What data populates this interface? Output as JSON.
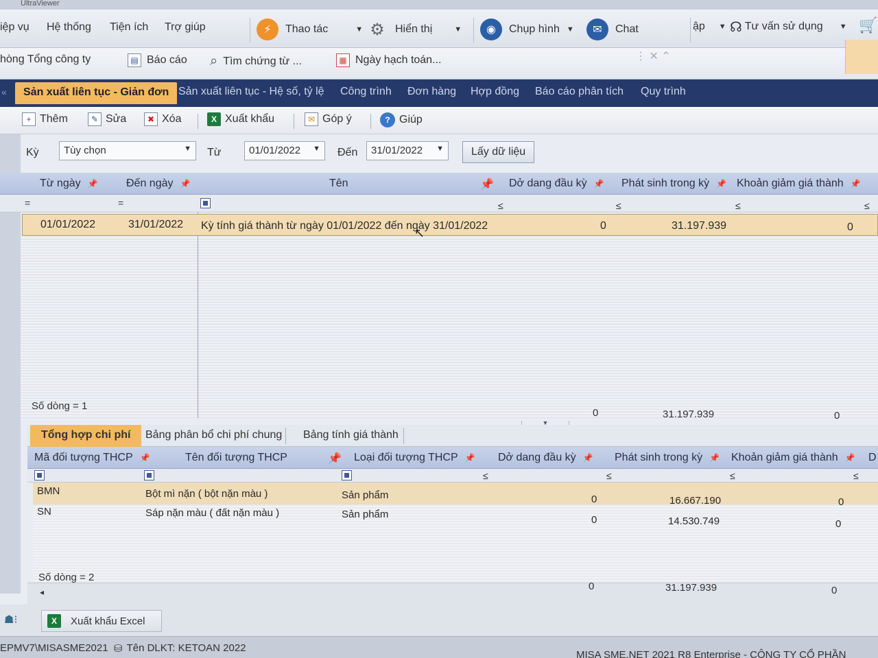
{
  "window": {
    "title": "UltraViewer"
  },
  "menubar": {
    "items": [
      "iệp vụ",
      "Hệ thống",
      "Tiện ích",
      "Trợ giúp"
    ],
    "tools": {
      "thao_tac": "Thao tác",
      "hien_thi": "Hiển thị",
      "chup_hinh": "Chụp hình",
      "chat": "Chat",
      "ap": "ập",
      "tu_van": "Tư vấn sử dụng"
    }
  },
  "toolbar2": {
    "company": "hòng Tổng công ty",
    "bao_cao": "Báo cáo",
    "tim_chung_tu": "Tìm chứng từ ...",
    "ngay_hach_toan": "Ngày hạch toán..."
  },
  "tabs": [
    "Sản xuất liên tục - Giản đơn",
    "Sản xuất liên tục - Hệ số, tỷ lệ",
    "Công trình",
    "Đơn hàng",
    "Hợp đồng",
    "Báo cáo phân tích",
    "Quy trình"
  ],
  "actions": {
    "them": "Thêm",
    "sua": "Sửa",
    "xoa": "Xóa",
    "xuat_khau": "Xuất khẩu",
    "gop_y": "Góp ý",
    "giup": "Giúp"
  },
  "filter": {
    "ky_label": "Kỳ",
    "ky_value": "Tùy chọn",
    "tu_label": "Từ",
    "tu_value": "01/01/2022",
    "den_label": "Đến",
    "den_value": "31/01/2022",
    "fetch_button": "Lấy dữ liệu"
  },
  "main_grid": {
    "headers": {
      "tu_ngay": "Từ ngày",
      "den_ngay": "Đến ngày",
      "ten": "Tên",
      "do_dang": "Dở dang đầu kỳ",
      "phat_sinh": "Phát sinh trong kỳ",
      "khoan_giam": "Khoản giảm giá thành"
    },
    "filter_ops": {
      "eq": "=",
      "le": "≤"
    },
    "row": {
      "tu_ngay": "01/01/2022",
      "den_ngay": "31/01/2022",
      "ten": "Kỳ tính giá thành từ ngày 01/01/2022 đến ngày 31/01/2022",
      "do_dang": "0",
      "phat_sinh": "31.197.939",
      "khoan_giam": "0"
    },
    "row_count": "Số dòng = 1",
    "totals": {
      "do_dang": "0",
      "phat_sinh": "31.197.939",
      "khoan_giam": "0"
    }
  },
  "subtabs": [
    "Tổng hợp chi phí",
    "Bảng phân bổ chi phí chung",
    "Bảng tính giá thành"
  ],
  "sub_grid": {
    "headers": {
      "ma": "Mã đối tượng THCP",
      "ten": "Tên đối tượng THCP",
      "loai": "Loại đối tượng THCP",
      "do_dang": "Dở dang đầu kỳ",
      "phat_sinh": "Phát sinh trong kỳ",
      "khoan_giam": "Khoản giảm giá thành",
      "extra": "D"
    },
    "rows": [
      {
        "ma": "BMN",
        "ten": "Bột mì nặn ( bột nặn màu )",
        "loai": "Sản phẩm",
        "do_dang": "0",
        "phat_sinh": "16.667.190",
        "khoan_giam": "0"
      },
      {
        "ma": "SN",
        "ten": "Sáp nặn màu ( đất nặn màu )",
        "loai": "Sản phẩm",
        "do_dang": "0",
        "phat_sinh": "14.530.749",
        "khoan_giam": "0"
      }
    ],
    "row_count": "Số dòng = 2",
    "totals": {
      "do_dang": "0",
      "phat_sinh": "31.197.939",
      "khoan_giam": "0"
    }
  },
  "bottom": {
    "export_excel": "Xuất khẩu Excel"
  },
  "status": {
    "path": "EPMV7\\MISASME2021",
    "db": "Tên DLKT: KETOAN 2022",
    "product": "MISA SME.NET 2021 R8 Enterprise - CÔNG TY CỔ PHẦN"
  }
}
